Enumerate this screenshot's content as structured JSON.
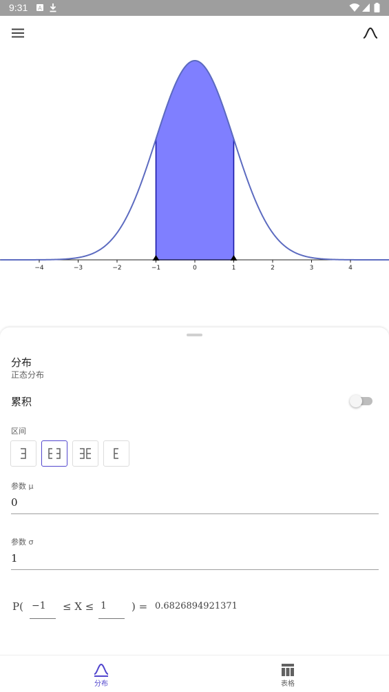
{
  "status_bar": {
    "time": "9:31"
  },
  "app_bar": {
    "menu_icon": "menu-icon",
    "distribution_icon": "bell-curve-icon"
  },
  "graph": {
    "mean": 0,
    "sd": 1,
    "x_min": -5.0,
    "x_max": 5.0,
    "shade_from": -1,
    "shade_to": 1,
    "curve_color": "#5c6bc0",
    "fill_color": "#7f7fff",
    "ticks": [
      {
        "v": -4,
        "label": "−4"
      },
      {
        "v": -3,
        "label": "−3"
      },
      {
        "v": -2,
        "label": "−2"
      },
      {
        "v": -1,
        "label": "−1"
      },
      {
        "v": 0,
        "label": "0"
      },
      {
        "v": 1,
        "label": "1"
      },
      {
        "v": 2,
        "label": "2"
      },
      {
        "v": 3,
        "label": "3"
      },
      {
        "v": 4,
        "label": "4"
      }
    ]
  },
  "panel": {
    "distribution_title": "分布",
    "distribution_name": "正态分布",
    "cumulative_label": "累积",
    "cumulative_on": false,
    "interval_label": "区间",
    "interval_options": [
      "left-sided-icon",
      "two-sided-icon",
      "outside-icon",
      "right-sided-icon"
    ],
    "interval_selected": 1,
    "param_mu_label": "参数 μ",
    "param_mu_value": "0",
    "param_sigma_label": "参数 σ",
    "param_sigma_value": "1",
    "prob": {
      "prefix": "P(",
      "lower": "−1",
      "middle": "≤ X ≤",
      "upper": "1",
      "suffix": ") =",
      "result": "0.6826894921371"
    }
  },
  "bottom_nav": {
    "items": [
      {
        "label": "分布",
        "icon": "distribution-icon",
        "active": true
      },
      {
        "label": "表格",
        "icon": "table-icon",
        "active": false
      }
    ],
    "active_color": "#5145cd",
    "inactive_color": "#616161"
  }
}
